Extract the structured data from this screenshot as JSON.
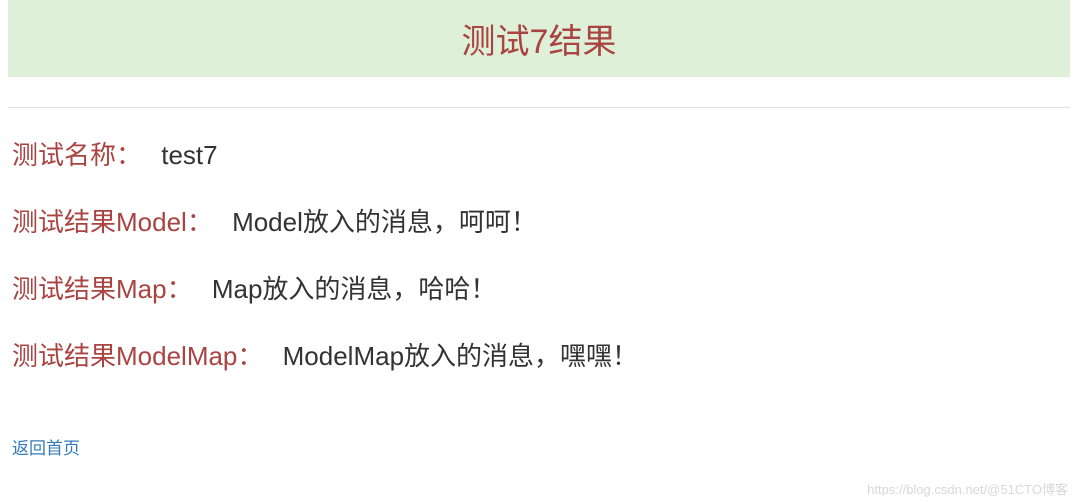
{
  "header": {
    "title": "测试7结果"
  },
  "rows": [
    {
      "label": "测试名称：",
      "value": "test7"
    },
    {
      "label": "测试结果Model：",
      "value": "Model放入的消息，呵呵！"
    },
    {
      "label": "测试结果Map：",
      "value": "Map放入的消息，哈哈！"
    },
    {
      "label": "测试结果ModelMap：",
      "value": "ModelMap放入的消息，嘿嘿！"
    }
  ],
  "backLink": "返回首页",
  "watermark": "https://blog.csdn.net/@51CTO博客"
}
